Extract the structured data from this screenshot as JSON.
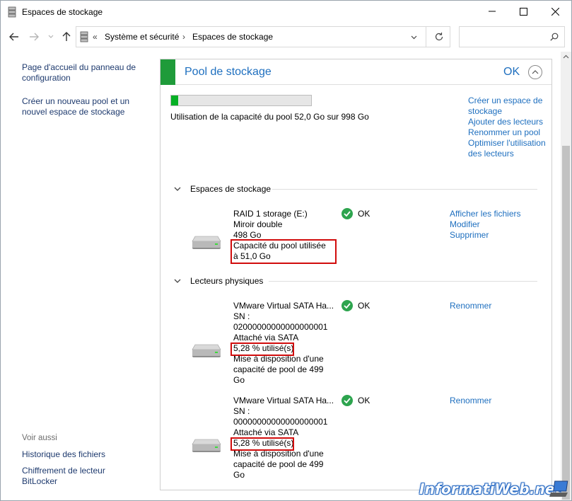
{
  "window": {
    "title": "Espaces de stockage"
  },
  "address": {
    "overflow": "«",
    "crumbs": [
      "Système et sécurité",
      "Espaces de stockage"
    ],
    "search_placeholder": ""
  },
  "left_pane": {
    "links": [
      "Page d'accueil du panneau de configuration",
      "Créer un nouveau pool et un nouvel espace de stockage"
    ],
    "see_also_label": "Voir aussi",
    "see_also_links": [
      "Historique des fichiers",
      "Chiffrement de lecteur BitLocker"
    ]
  },
  "pool": {
    "title": "Pool de stockage",
    "status": "OK",
    "usage_fraction": 0.052,
    "usage_text": "Utilisation de la capacité du pool 52,0 Go sur 998 Go",
    "actions": [
      "Créer un espace de stockage",
      "Ajouter des lecteurs",
      "Renommer un pool",
      "Optimiser l'utilisation des lecteurs"
    ]
  },
  "spaces_section": {
    "label": "Espaces de stockage",
    "items": [
      {
        "name": "RAID 1 storage (E:)",
        "type": "Miroir double",
        "size": "498 Go",
        "pool_used": "Capacité du pool utilisée à 51,0 Go",
        "status": "OK",
        "actions": [
          "Afficher les fichiers",
          "Modifier",
          "Supprimer"
        ]
      }
    ]
  },
  "drives_section": {
    "label": "Lecteurs physiques",
    "items": [
      {
        "name": "VMware Virtual SATA Ha...",
        "sn_label": "SN :",
        "sn": "02000000000000000001",
        "attached": "Attaché via SATA",
        "used": "5,28 % utilisé(s)",
        "provided": "Mise à disposition d'une capacité de pool de 499 Go",
        "status": "OK",
        "action": "Renommer"
      },
      {
        "name": "VMware Virtual SATA Ha...",
        "sn_label": "SN :",
        "sn": "00000000000000000001",
        "attached": "Attaché via SATA",
        "used": "5,28 % utilisé(s)",
        "provided": "Mise à disposition d'une capacité de pool de 499 Go",
        "status": "OK",
        "action": "Renommer"
      }
    ]
  },
  "watermark": "InformatiWeb.net",
  "colors": {
    "accent": "#1e6fbf",
    "pool_green": "#1f9b3a",
    "ok_green": "#2da44e",
    "highlight_red": "#d10c0c"
  }
}
